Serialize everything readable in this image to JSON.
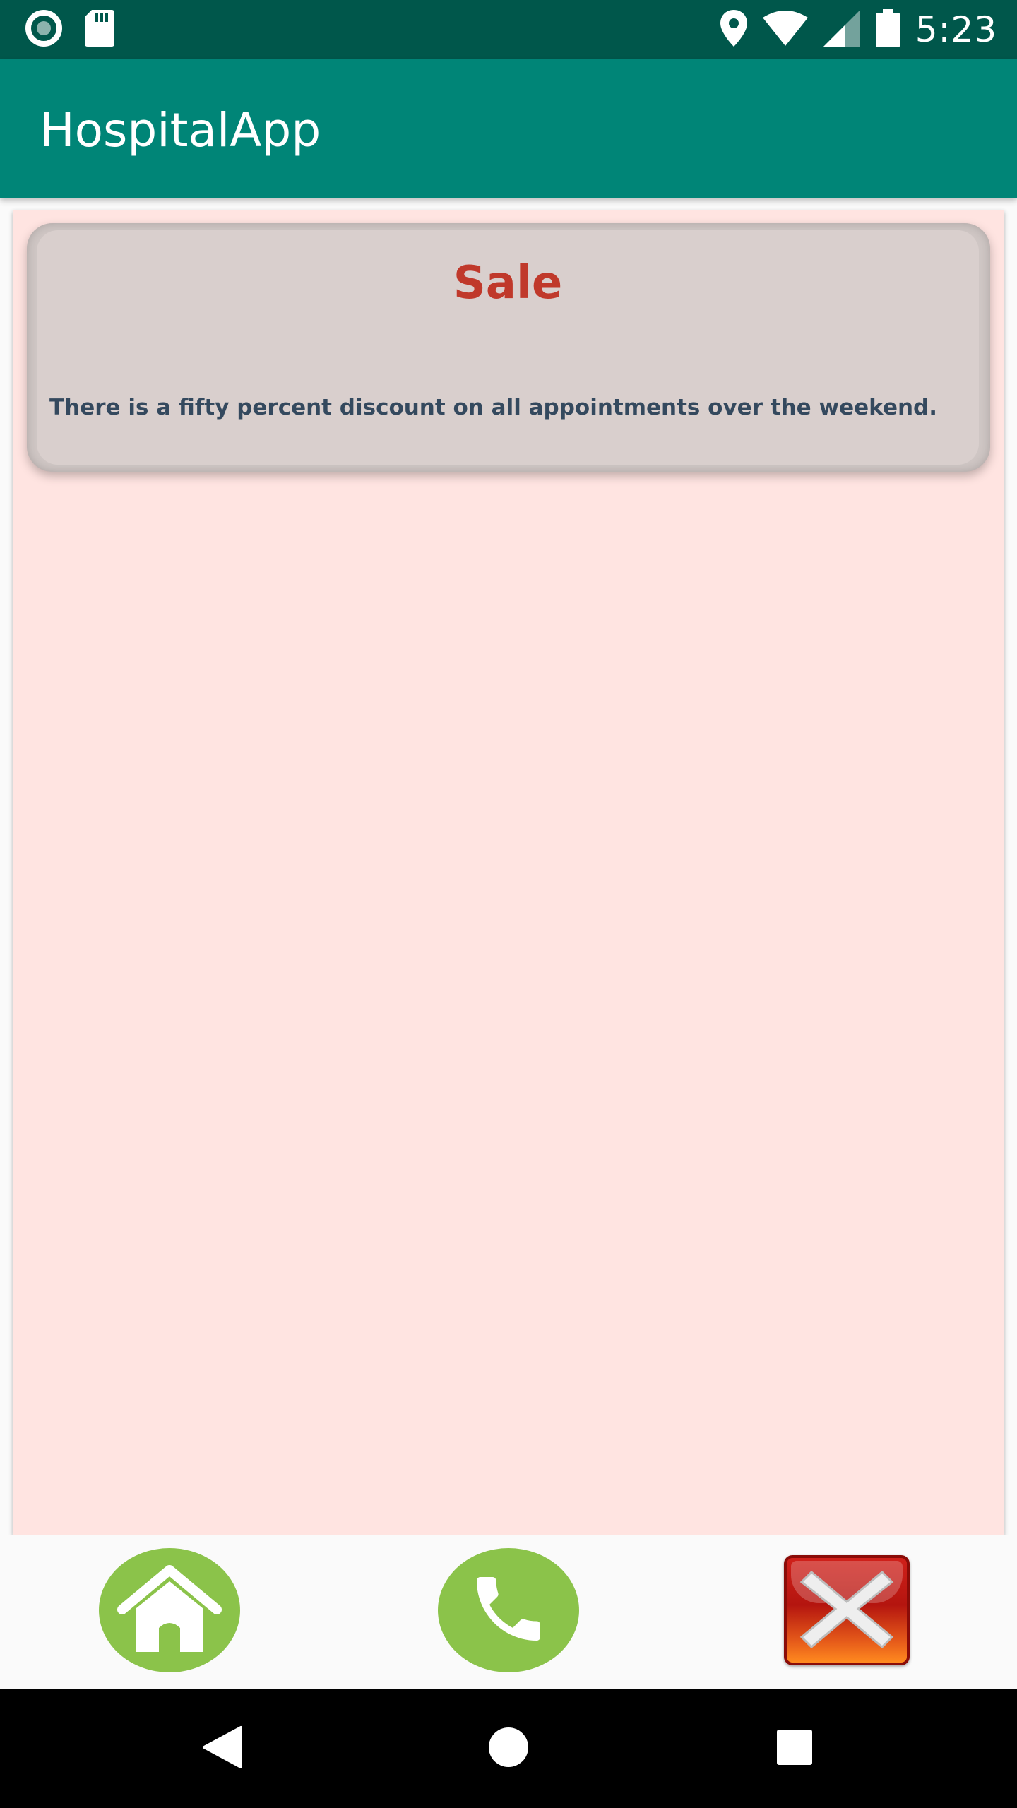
{
  "status_bar": {
    "time": "5:23",
    "icons": [
      "record-icon",
      "sd-card-icon",
      "location-icon",
      "wifi-icon",
      "signal-icon",
      "battery-icon"
    ]
  },
  "app_bar": {
    "title": "HospitalApp",
    "color": "#008577"
  },
  "card": {
    "title": "Sale",
    "body": "There is a fifty percent discount on all appointments over the weekend.",
    "title_color": "#c0392b",
    "body_color": "#34495e"
  },
  "actions": [
    {
      "name": "home",
      "icon": "home-icon",
      "color": "#8bc34a"
    },
    {
      "name": "call",
      "icon": "phone-icon",
      "color": "#8bc34a"
    },
    {
      "name": "close",
      "icon": "close-icon",
      "color": "#c0201a"
    }
  ],
  "nav_bar": {
    "icons": [
      "back-icon",
      "home-circle-icon",
      "recents-icon"
    ]
  },
  "colors": {
    "status_bar": "#00574b",
    "panel_background": "#ffe4e1",
    "card_background": "#d9cfcd"
  }
}
